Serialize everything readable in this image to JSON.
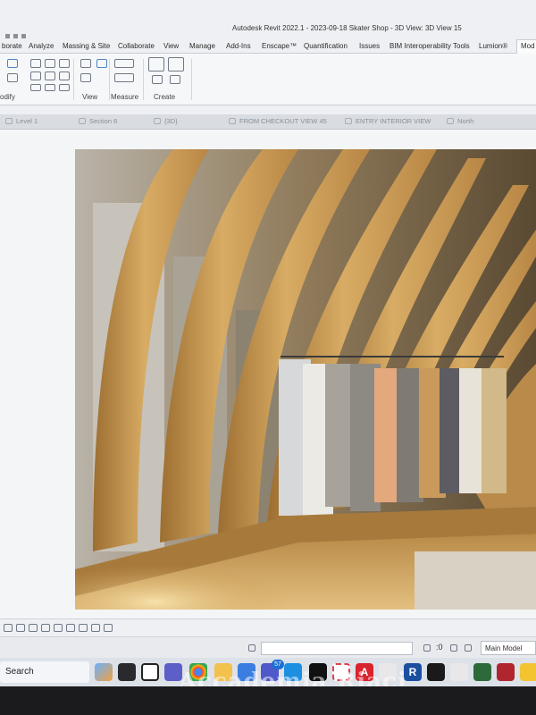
{
  "window": {
    "title": "Autodesk Revit 2022.1 - 2023-09-18 Skater Shop - 3D View: 3D View 15"
  },
  "ribbon": {
    "tabs": [
      "borate",
      "Analyze",
      "Massing & Site",
      "Collaborate",
      "View",
      "Manage",
      "Add-Ins",
      "Enscape™",
      "Quantification",
      "Issues",
      "BIM Interoperability Tools",
      "Lumion®",
      "Mod"
    ],
    "active_tab": "Mod",
    "panels": [
      "odify",
      "View",
      "Measure",
      "Create"
    ]
  },
  "view_tabs": [
    "Level 1",
    "Section 6",
    "{3D}",
    "FROM CHECKOUT VIEW 45",
    "ENTRY INTERIOR VIEW",
    "North"
  ],
  "status_bar": {
    "coord": ":0",
    "model": "Main Model"
  },
  "taskbar": {
    "search_label": "Search",
    "teams_badge": "57",
    "app_letters": {
      "acrobat": "A",
      "revit": "R"
    }
  },
  "watermark": "Accademia Riaci",
  "colors": {
    "wood": "#c99a4f",
    "wood_light": "#e3bf7f",
    "ribbon_bg": "#f6f7f9",
    "taskbar_bg": "#dde1e8"
  }
}
